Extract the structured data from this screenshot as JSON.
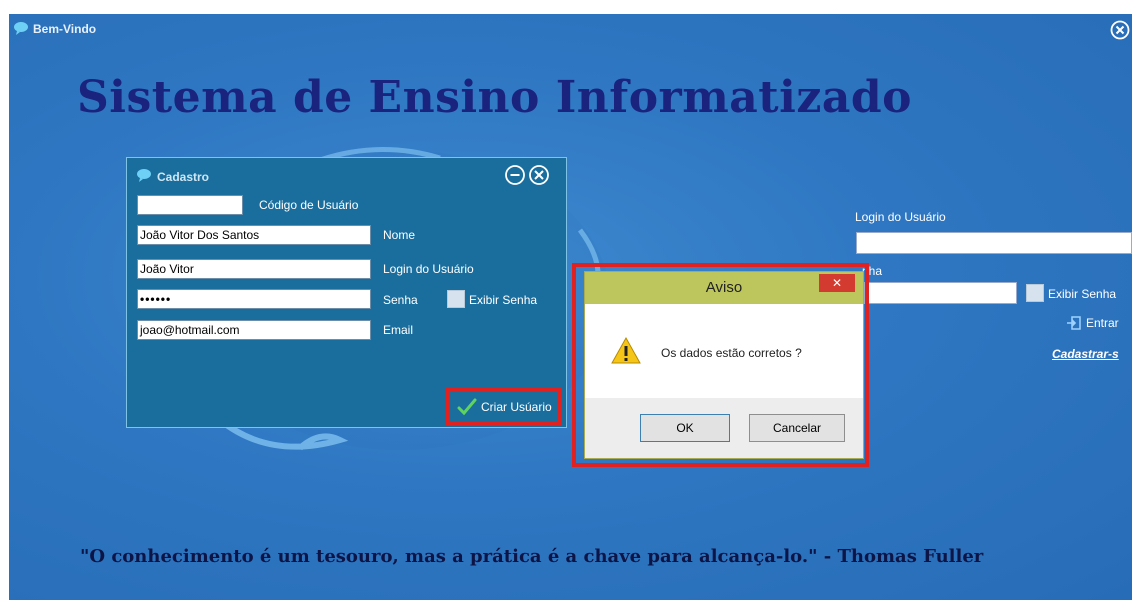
{
  "main": {
    "title": "Bem-Vindo",
    "heading": "Sistema de Ensino Informatizado",
    "quote": "\"O conhecimento é um tesouro, mas a prática é a chave para alcança-lo.\" - Thomas Fuller"
  },
  "login": {
    "login_label": "Login do Usuário",
    "senha_label_partial": "nha",
    "show_password_label": "Exibir Senha",
    "enter_label": "Entrar",
    "register_link": "Cadastrar-s"
  },
  "cadastro": {
    "title": "Cadastro",
    "codigo_value": "",
    "codigo_label": "Código de Usuário",
    "nome_value": "João Vitor Dos Santos",
    "nome_label": "Nome",
    "login_value": "João Vitor",
    "login_label": "Login do Usuário",
    "senha_value": "••••••",
    "senha_label": "Senha",
    "show_password_label": "Exibir Senha",
    "email_value": "joao@hotmail.com",
    "email_label": "Email",
    "create_button": "Criar Usúario"
  },
  "aviso": {
    "title": "Aviso",
    "close": "✕",
    "message": "Os dados estão corretos ?",
    "ok_button": "OK",
    "cancel_button": "Cancelar"
  },
  "colors": {
    "background": "#2f77c2",
    "heading": "#1a237e",
    "cadastro_panel": "#1a6e9e",
    "highlight": "#e0211f",
    "dialog_header": "#bcc65c",
    "close_button": "#d43b30"
  },
  "icons": [
    "app-logo-icon",
    "close-circle-icon",
    "minimize-circle-icon",
    "checkmark-icon",
    "warning-icon",
    "enter-icon"
  ]
}
